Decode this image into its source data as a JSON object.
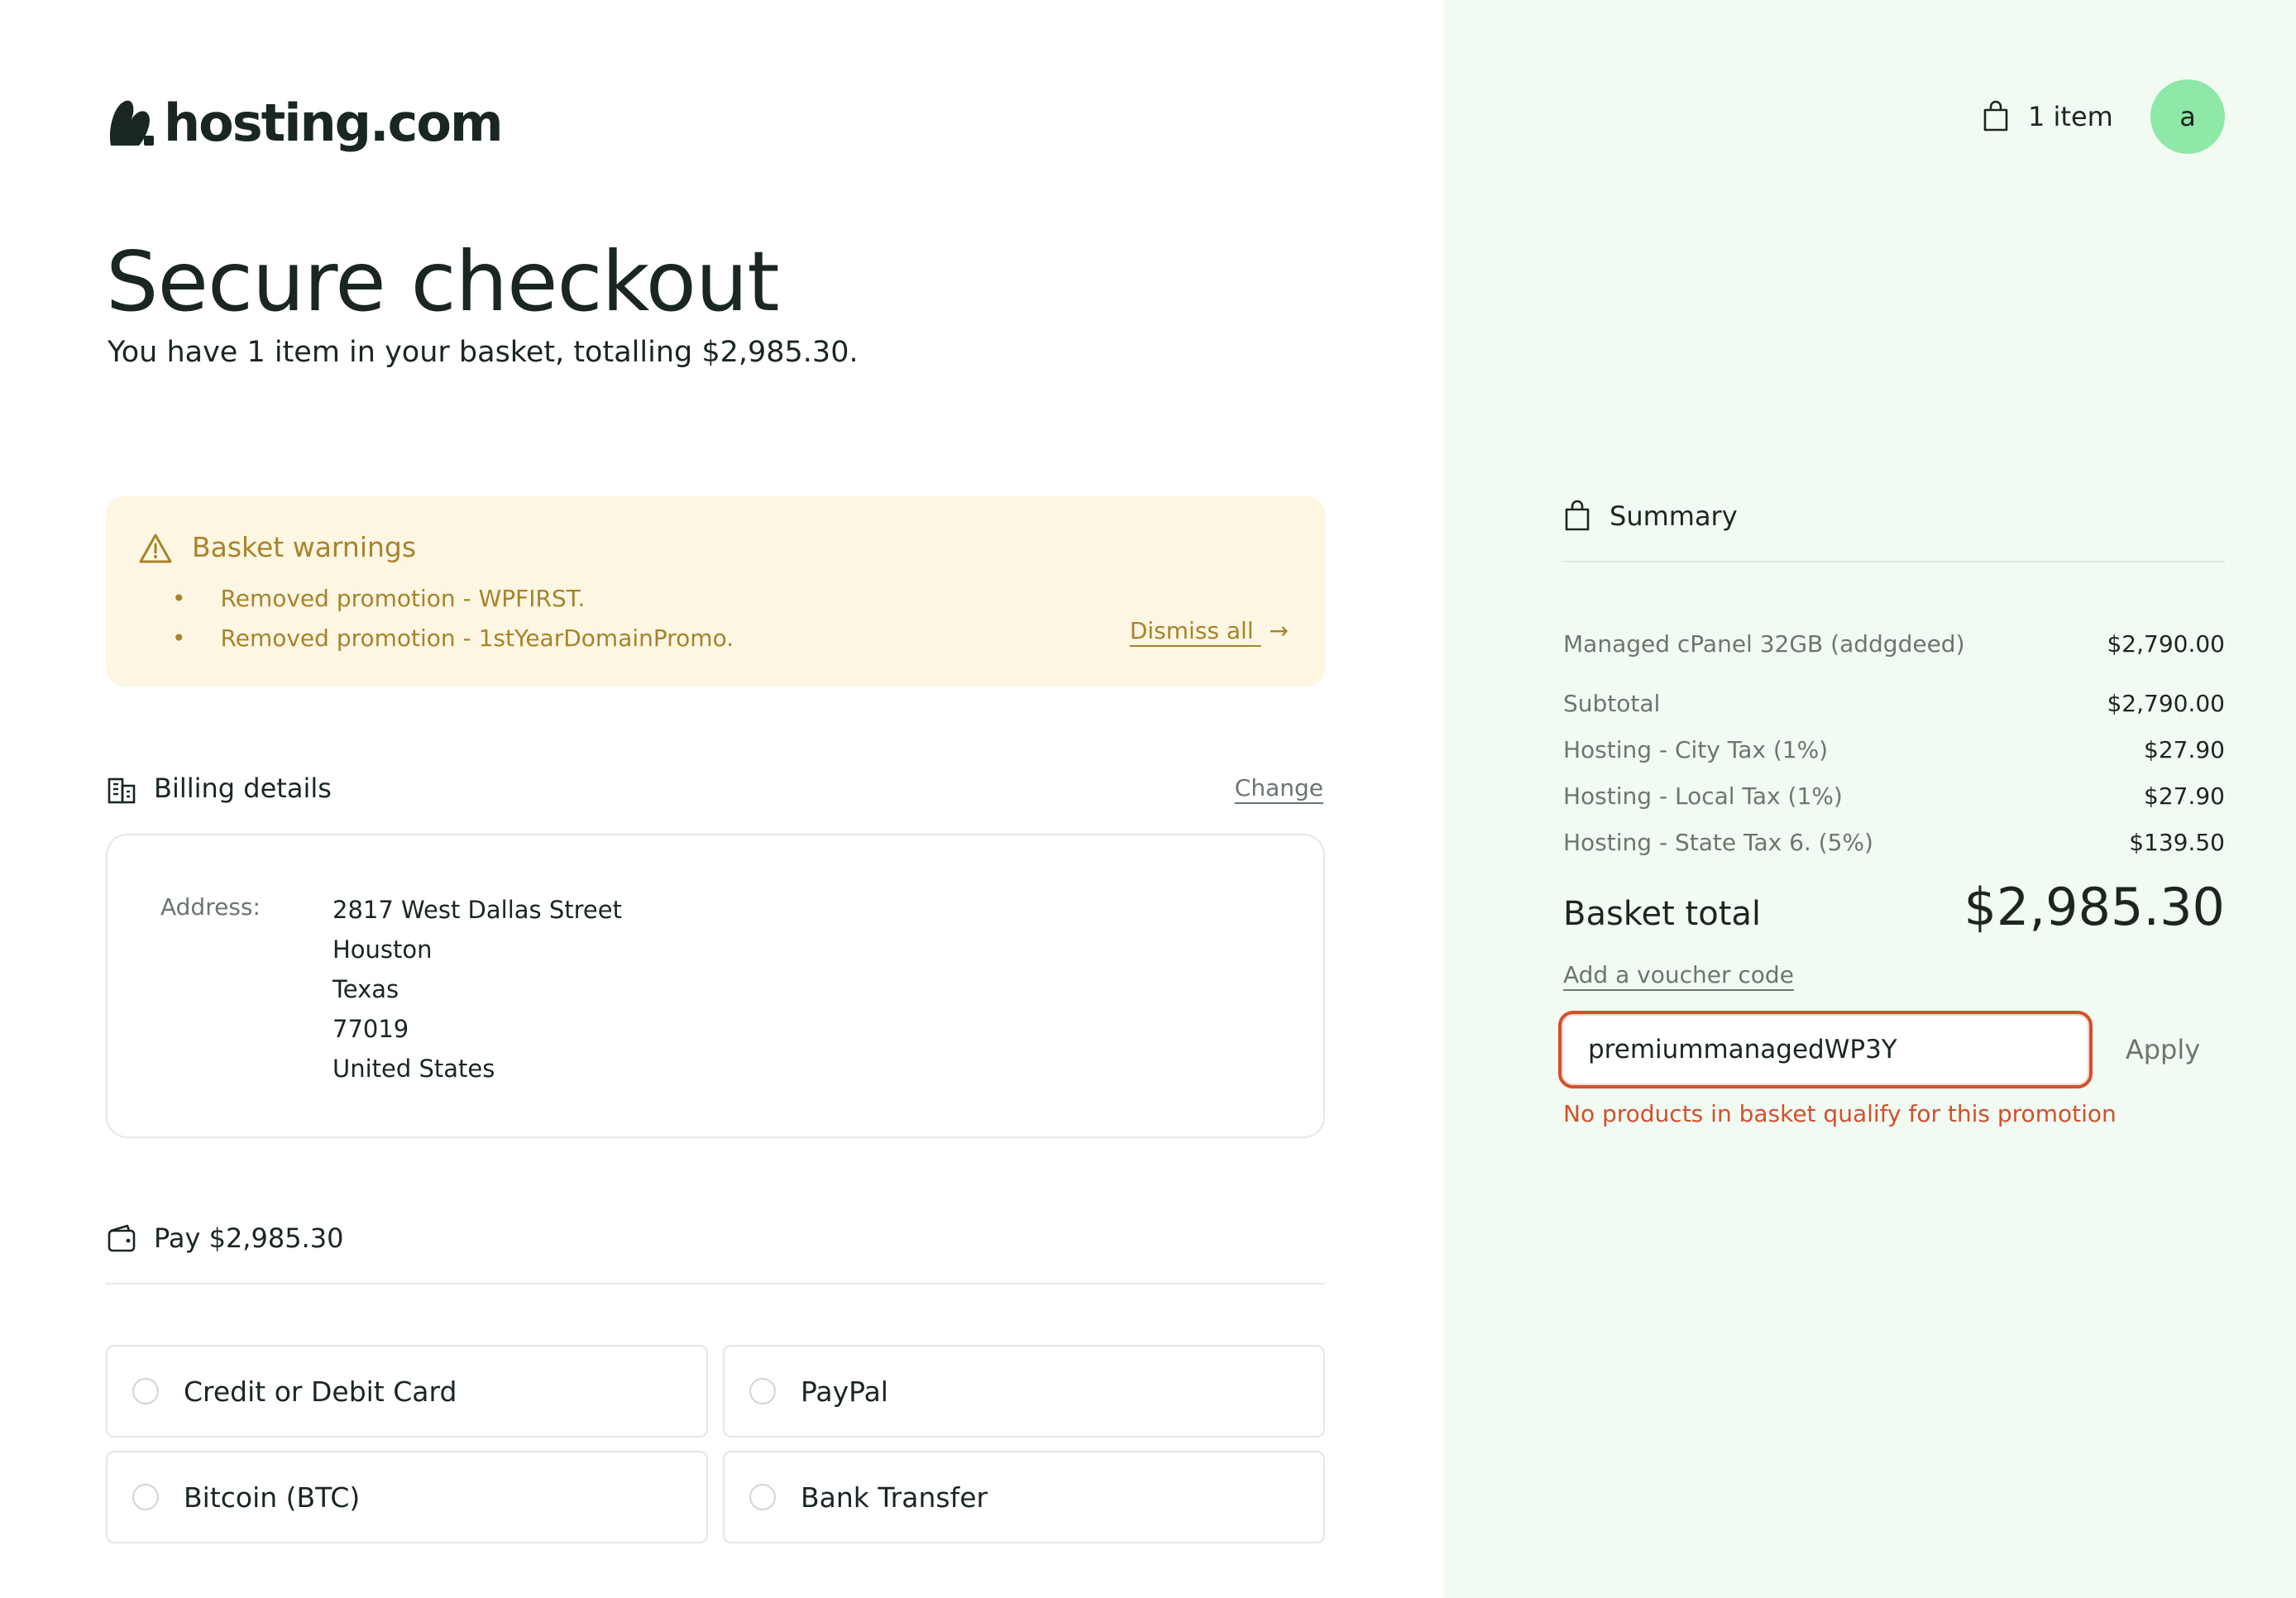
{
  "brand": {
    "name": "hosting.com"
  },
  "header": {
    "cart_label": "1 item",
    "avatar_initial": "a"
  },
  "checkout": {
    "title": "Secure checkout",
    "subtitle": "You have 1 item in your basket, totalling $2,985.30."
  },
  "warnings": {
    "title": "Basket warnings",
    "items": [
      "Removed promotion - WPFIRST.",
      "Removed promotion - 1stYearDomainPromo."
    ],
    "dismiss_label": "Dismiss all",
    "dismiss_arrow": "→"
  },
  "billing": {
    "title": "Billing details",
    "change_label": "Change",
    "address_label": "Address:",
    "address_lines": [
      "2817 West Dallas Street",
      "Houston",
      "Texas",
      "77019",
      "United States"
    ]
  },
  "payment": {
    "title": "Pay $2,985.30",
    "options": [
      "Credit or Debit Card",
      "PayPal",
      "Bitcoin (BTC)",
      "Bank Transfer"
    ]
  },
  "summary": {
    "title": "Summary",
    "items": [
      {
        "label": "Managed cPanel 32GB (addgdeed)",
        "value": "$2,790.00"
      }
    ],
    "lines": [
      {
        "label": "Subtotal",
        "value": "$2,790.00"
      },
      {
        "label": "Hosting - City Tax (1%)",
        "value": "$27.90"
      },
      {
        "label": "Hosting - Local Tax (1%)",
        "value": "$27.90"
      },
      {
        "label": "Hosting - State Tax 6. (5%)",
        "value": "$139.50"
      }
    ],
    "total_label": "Basket total",
    "total_value": "$2,985.30",
    "voucher_link": "Add a voucher code",
    "voucher_value": "premiummanagedWP3Y",
    "apply_label": "Apply",
    "voucher_error": "No products in basket qualify for this promotion"
  },
  "colors": {
    "accent_green": "#8ee8a8",
    "panel_bg": "#f1fbf1",
    "warning_bg": "#fdf6e3",
    "warning_text": "#a8832a",
    "error": "#d4502c"
  }
}
